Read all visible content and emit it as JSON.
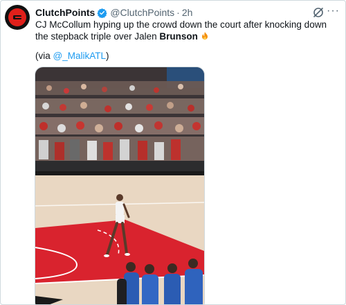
{
  "account": {
    "display_name": "ClutchPoints",
    "handle": "@ClutchPoints",
    "separator": "·",
    "time": "2h"
  },
  "tweet": {
    "text_lead": "CJ McCollum hyping up the crowd down the court after knocking down the stepback triple over Jalen ",
    "text_bold": "Brunson",
    "credit_prefix": "(via ",
    "credit_mention": "@_MalikATL",
    "credit_suffix": ")"
  },
  "icons": {
    "avatar": "clutchpoints-logo-icon",
    "verified": "verified-badge-icon",
    "grok": "grok-icon",
    "more": "more-options-icon",
    "emoji": "fire-emoji-icon"
  },
  "colors": {
    "text": "#0f1419",
    "secondary": "#536471",
    "accent": "#1d9bf0",
    "brand_red": "#e0201b",
    "court_red": "#d9232e"
  }
}
